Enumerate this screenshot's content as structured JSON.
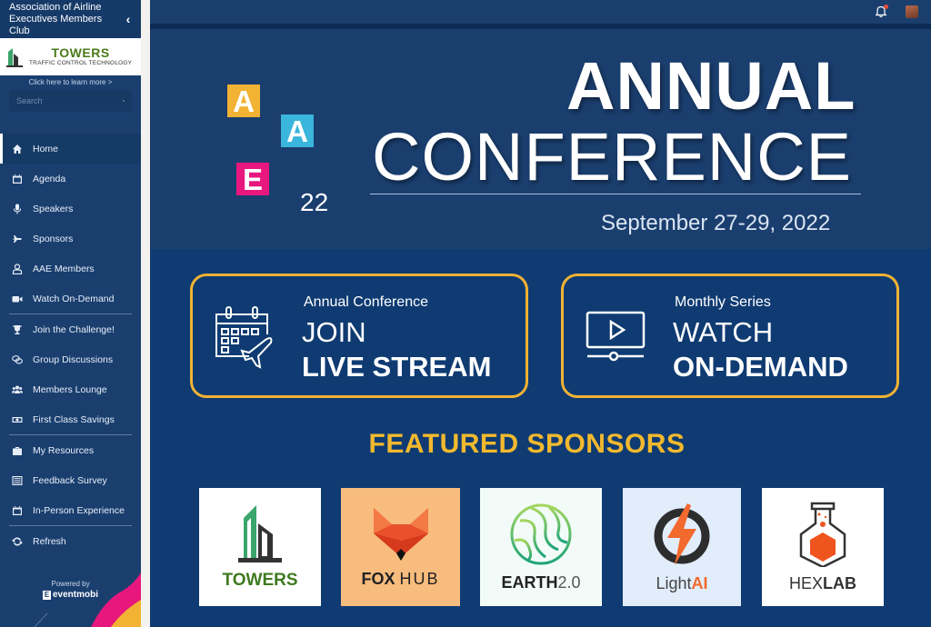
{
  "sidebar": {
    "title": "Association of Airline Executives Members Club",
    "collapse_icon": "chevron-left-icon",
    "banner": {
      "name": "TOWERS",
      "tagline": "TRAFFIC CONTROL TECHNOLOGY",
      "learn_more": "Click here to learn more >"
    },
    "search": {
      "placeholder": "Search",
      "value": ""
    },
    "nav_groups": [
      [
        {
          "label": "Home",
          "icon": "home-icon",
          "active": true
        },
        {
          "label": "Agenda",
          "icon": "calendar-icon"
        },
        {
          "label": "Speakers",
          "icon": "microphone-icon"
        },
        {
          "label": "Sponsors",
          "icon": "plane-icon"
        },
        {
          "label": "AAE Members",
          "icon": "user-icon"
        },
        {
          "label": "Watch On-Demand",
          "icon": "video-icon"
        }
      ],
      [
        {
          "label": "Join the Challenge!",
          "icon": "trophy-icon"
        },
        {
          "label": "Group Discussions",
          "icon": "chat-icon"
        },
        {
          "label": "Members Lounge",
          "icon": "users-icon"
        },
        {
          "label": "First Class Savings",
          "icon": "money-icon"
        }
      ],
      [
        {
          "label": "My Resources",
          "icon": "briefcase-icon"
        },
        {
          "label": "Feedback Survey",
          "icon": "list-icon"
        },
        {
          "label": "In-Person Experience",
          "icon": "calendar-icon"
        }
      ],
      [
        {
          "label": "Refresh",
          "icon": "refresh-icon"
        }
      ]
    ],
    "powered_by": "Powered by",
    "powered_brand": "eventmobi"
  },
  "topbar": {
    "notifications_icon": "bell-icon",
    "has_unread": true,
    "avatar": "user-avatar"
  },
  "hero": {
    "logo_letters": [
      "A",
      "A",
      "E"
    ],
    "logo_year": "22",
    "title_line1": "ANNUAL",
    "title_line2": "CONFERENCE",
    "date": "September 27-29, 2022",
    "colors": {
      "yellow": "#f2b233",
      "blue": "#3ab5db",
      "pink": "#e8177d"
    }
  },
  "cta": [
    {
      "small": "Annual Conference",
      "mid": "JOIN",
      "big": "LIVE STREAM",
      "icon": "calendar-plane-icon"
    },
    {
      "small": "Monthly Series",
      "mid": "WATCH",
      "big": "ON-DEMAND",
      "icon": "video-player-icon"
    }
  ],
  "sponsors": {
    "title": "FEATURED SPONSORS",
    "items": [
      {
        "name": "TOWERS"
      },
      {
        "name": "FOX",
        "name2": "HUB"
      },
      {
        "name": "EARTH",
        "name2": "2.0"
      },
      {
        "name": "Light",
        "name2": "AI"
      },
      {
        "name": "HEX",
        "name2": "LAB"
      }
    ]
  },
  "colors": {
    "sidebar_bg": "#1a3f6f",
    "main_bg": "#0f3b72",
    "accent_gold": "#f2b233"
  }
}
